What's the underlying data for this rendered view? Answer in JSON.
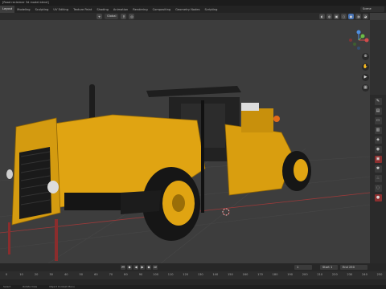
{
  "title_bar": {
    "text": "[Road reclaimer 3d model.blend]"
  },
  "workspaces": [
    {
      "label": "Layout",
      "active": true
    },
    {
      "label": "Modeling",
      "active": false
    },
    {
      "label": "Sculpting",
      "active": false
    },
    {
      "label": "UV Editing",
      "active": false
    },
    {
      "label": "Texture Paint",
      "active": false
    },
    {
      "label": "Shading",
      "active": false
    },
    {
      "label": "Animation",
      "active": false
    },
    {
      "label": "Rendering",
      "active": false
    },
    {
      "label": "Compositing",
      "active": false
    },
    {
      "label": "Geometry Nodes",
      "active": false
    },
    {
      "label": "Scripting",
      "active": false
    }
  ],
  "scene": {
    "label": "Scene"
  },
  "header": {
    "transform_orientation": "Global",
    "options_label": "Options"
  },
  "timeline": {
    "current_frame": "1",
    "start_label": "Start",
    "start_value": "1",
    "end_label": "End",
    "end_value": "250",
    "ruler_ticks": [
      "0",
      "10",
      "20",
      "30",
      "40",
      "50",
      "60",
      "70",
      "80",
      "90",
      "100",
      "110",
      "120",
      "130",
      "140",
      "150",
      "160",
      "170",
      "180",
      "190",
      "200",
      "210",
      "220",
      "230",
      "240",
      "250"
    ]
  },
  "status": {
    "left": "Select",
    "middle": "Rotate View",
    "right": "Object Context Menu"
  },
  "colors": {
    "body_yellow": "#e0a412",
    "tire": "#1a1a1a",
    "viewport_bg": "#3d3d3d",
    "axis_red": "#b03a3a",
    "accent_blue": "#4772b3"
  }
}
